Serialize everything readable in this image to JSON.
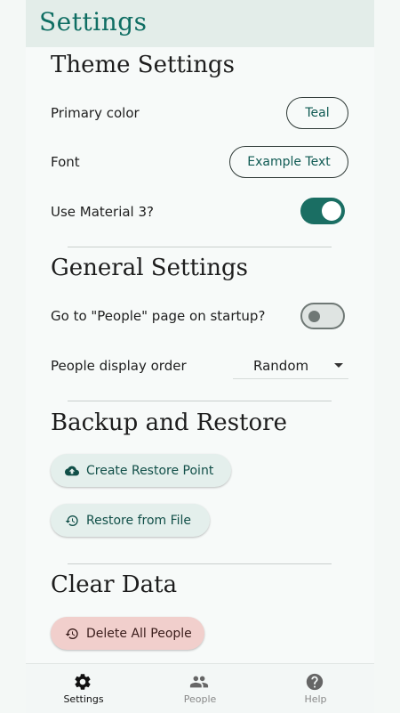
{
  "app_bar": {
    "title": "Settings"
  },
  "theme": {
    "title": "Theme Settings",
    "primary_color_label": "Primary color",
    "primary_color_value": "Teal",
    "font_label": "Font",
    "font_value": "Example Text",
    "material3_label": "Use Material 3?",
    "material3_on": true
  },
  "general": {
    "title": "General Settings",
    "startup_label": "Go to \"People\" page on startup?",
    "startup_on": false,
    "order_label": "People display order",
    "order_value": "Random"
  },
  "backup": {
    "title": "Backup and Restore",
    "create_label": "Create Restore Point",
    "restore_label": "Restore from File"
  },
  "clear": {
    "title": "Clear Data",
    "delete_label": "Delete All People"
  },
  "nav": {
    "items": [
      {
        "label": "Settings",
        "icon": "gear-icon",
        "active": true
      },
      {
        "label": "People",
        "icon": "people-icon",
        "active": false
      },
      {
        "label": "Help",
        "icon": "help-icon",
        "active": false
      }
    ]
  },
  "colors": {
    "accent": "#1a6e63",
    "app_bar_bg": "#e3ede9",
    "danger_bg": "#f1cfcc"
  }
}
